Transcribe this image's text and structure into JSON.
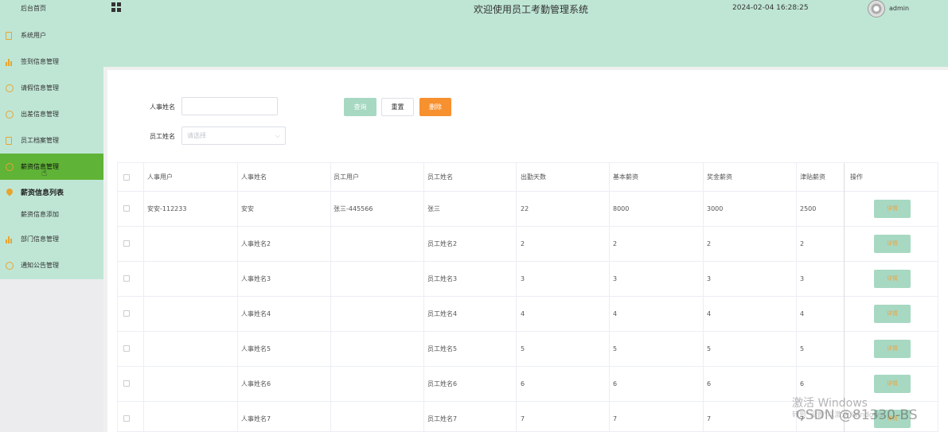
{
  "header": {
    "title": "欢迎使用员工考勤管理系统",
    "datetime": "2024-02-04 16:28:25",
    "user": "admin"
  },
  "sidebar": {
    "items": [
      {
        "label": "后台首页",
        "icon": "home-icon"
      },
      {
        "label": "系统用户",
        "icon": "document-icon"
      },
      {
        "label": "签到信息管理",
        "icon": "bar-chart-icon"
      },
      {
        "label": "请假信息管理",
        "icon": "chat-icon"
      },
      {
        "label": "出差信息管理",
        "icon": "check-circle-icon"
      },
      {
        "label": "员工档案管理",
        "icon": "document-icon"
      },
      {
        "label": "薪资信息管理",
        "icon": "circle-icon",
        "active": true
      },
      {
        "label": "薪资信息列表",
        "icon": "location-pin-icon",
        "sub": true,
        "bold": true
      },
      {
        "label": "薪资信息添加",
        "sub": true
      },
      {
        "label": "部门信息管理",
        "icon": "bar-chart-icon"
      },
      {
        "label": "通知公告管理",
        "icon": "check-circle-icon"
      }
    ]
  },
  "search": {
    "hr_name_label": "人事姓名",
    "hr_name_value": "",
    "employee_name_label": "员工姓名",
    "employee_name_placeholder": "请选择",
    "query_label": "查询",
    "reset_label": "重置",
    "delete_label": "删除"
  },
  "table": {
    "columns": [
      "人事用户",
      "人事姓名",
      "员工用户",
      "员工姓名",
      "出勤天数",
      "基本薪资",
      "奖金薪资",
      "津贴薪资",
      "操作"
    ],
    "detail_label": "详情",
    "rows": [
      [
        "安安-112233",
        "安安",
        "张三-445566",
        "张三",
        "22",
        "8000",
        "3000",
        "2500"
      ],
      [
        "",
        "人事姓名2",
        "",
        "员工姓名2",
        "2",
        "2",
        "2",
        "2"
      ],
      [
        "",
        "人事姓名3",
        "",
        "员工姓名3",
        "3",
        "3",
        "3",
        "3"
      ],
      [
        "",
        "人事姓名4",
        "",
        "员工姓名4",
        "4",
        "4",
        "4",
        "4"
      ],
      [
        "",
        "人事姓名5",
        "",
        "员工姓名5",
        "5",
        "5",
        "5",
        "5"
      ],
      [
        "",
        "人事姓名6",
        "",
        "员工姓名6",
        "6",
        "6",
        "6",
        "6"
      ],
      [
        "",
        "人事姓名7",
        "",
        "员工姓名7",
        "7",
        "7",
        "7",
        "7"
      ]
    ]
  },
  "watermark": {
    "line1": "激活 Windows",
    "line2": "转到\"设置\"以激活 Windows。",
    "csdn": "CSDN @81330-BS"
  },
  "colors": {
    "header_bg": "#bfe6d5",
    "active_menu": "#5fb336",
    "accent_orange": "#f7902f",
    "button_green": "#a7d8c2"
  }
}
